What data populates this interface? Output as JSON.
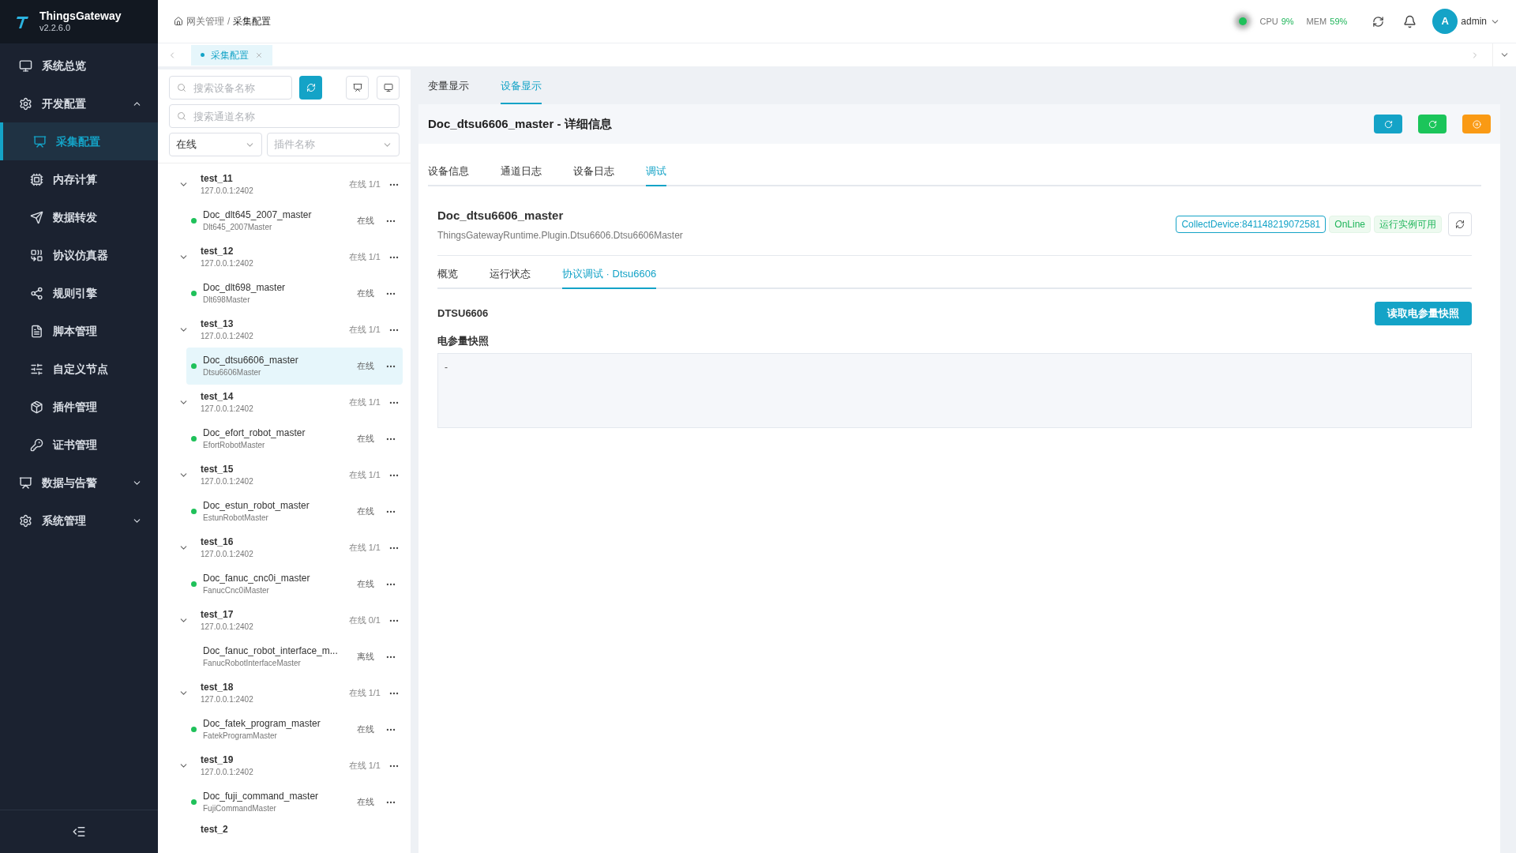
{
  "app": {
    "name": "ThingsGateway",
    "version": "v2.2.6.0"
  },
  "sidebar": {
    "items": [
      {
        "label": "系统总览",
        "selected": false
      },
      {
        "label": "开发配置",
        "expanded": true,
        "children": [
          {
            "label": "采集配置",
            "selected": true
          },
          {
            "label": "内存计算",
            "selected": false
          },
          {
            "label": "数据转发",
            "selected": false
          },
          {
            "label": "协议仿真器",
            "selected": false
          },
          {
            "label": "规则引擎",
            "selected": false
          },
          {
            "label": "脚本管理",
            "selected": false
          },
          {
            "label": "自定义节点",
            "selected": false
          },
          {
            "label": "插件管理",
            "selected": false
          },
          {
            "label": "证书管理",
            "selected": false
          }
        ]
      },
      {
        "label": "数据与告警",
        "expanded": false
      },
      {
        "label": "系统管理",
        "expanded": false
      }
    ]
  },
  "breadcrumb": [
    "网关管理",
    "采集配置"
  ],
  "breadcrumb_separator": "/",
  "status": {
    "online": true,
    "cpu_label": "CPU",
    "cpu": "9%",
    "mem_label": "MEM",
    "mem": "59%",
    "avatar": "A",
    "user": "admin"
  },
  "page_tabs": [
    {
      "label": "采集配置",
      "selected": true
    }
  ],
  "device_panel": {
    "device_search": {
      "placeholder": "搜索设备名称"
    },
    "channel_search": {
      "placeholder": "搜索通道名称"
    },
    "status_filter": {
      "value": "在线"
    },
    "plugin_filter": {
      "placeholder": "插件名称"
    },
    "groups": [
      {
        "name": "test_11",
        "address": "127.0.0.1:2402",
        "summary": "在线 1/1",
        "expanded": true,
        "children": [
          {
            "name": "Doc_dlt645_2007_master",
            "plugin": "Dlt645_2007Master",
            "status": "在线",
            "online": true,
            "selected": false
          }
        ]
      },
      {
        "name": "test_12",
        "address": "127.0.0.1:2402",
        "summary": "在线 1/1",
        "expanded": true,
        "children": [
          {
            "name": "Doc_dlt698_master",
            "plugin": "Dlt698Master",
            "status": "在线",
            "online": true,
            "selected": false
          }
        ]
      },
      {
        "name": "test_13",
        "address": "127.0.0.1:2402",
        "summary": "在线 1/1",
        "expanded": true,
        "children": [
          {
            "name": "Doc_dtsu6606_master",
            "plugin": "Dtsu6606Master",
            "status": "在线",
            "online": true,
            "selected": true
          }
        ]
      },
      {
        "name": "test_14",
        "address": "127.0.0.1:2402",
        "summary": "在线 1/1",
        "expanded": true,
        "children": [
          {
            "name": "Doc_efort_robot_master",
            "plugin": "EfortRobotMaster",
            "status": "在线",
            "online": true,
            "selected": false
          }
        ]
      },
      {
        "name": "test_15",
        "address": "127.0.0.1:2402",
        "summary": "在线 1/1",
        "expanded": true,
        "children": [
          {
            "name": "Doc_estun_robot_master",
            "plugin": "EstunRobotMaster",
            "status": "在线",
            "online": true,
            "selected": false
          }
        ]
      },
      {
        "name": "test_16",
        "address": "127.0.0.1:2402",
        "summary": "在线 1/1",
        "expanded": true,
        "children": [
          {
            "name": "Doc_fanuc_cnc0i_master",
            "plugin": "FanucCnc0iMaster",
            "status": "在线",
            "online": true,
            "selected": false
          }
        ]
      },
      {
        "name": "test_17",
        "address": "127.0.0.1:2402",
        "summary": "在线 0/1",
        "expanded": true,
        "children": [
          {
            "name": "Doc_fanuc_robot_interface_m...",
            "plugin": "FanucRobotInterfaceMaster",
            "status": "离线",
            "online": false,
            "selected": false
          }
        ]
      },
      {
        "name": "test_18",
        "address": "127.0.0.1:2402",
        "summary": "在线 1/1",
        "expanded": true,
        "children": [
          {
            "name": "Doc_fatek_program_master",
            "plugin": "FatekProgramMaster",
            "status": "在线",
            "online": true,
            "selected": false
          }
        ]
      },
      {
        "name": "test_19",
        "address": "127.0.0.1:2402",
        "summary": "在线 1/1",
        "expanded": true,
        "children": [
          {
            "name": "Doc_fuji_command_master",
            "plugin": "FujiCommandMaster",
            "status": "在线",
            "online": true,
            "selected": false
          }
        ]
      },
      {
        "name": "test_2"
      }
    ]
  },
  "detail": {
    "view_tabs": [
      {
        "label": "变量显示",
        "selected": false
      },
      {
        "label": "设备显示",
        "selected": true
      }
    ],
    "title": "Doc_dtsu6606_master - 详细信息",
    "actions": [
      {
        "color": "#14a3c7"
      },
      {
        "color": "#1bc55a"
      },
      {
        "color": "#fa9a14"
      }
    ],
    "tabs": [
      {
        "label": "设备信息",
        "selected": false
      },
      {
        "label": "通道日志",
        "selected": false
      },
      {
        "label": "设备日志",
        "selected": false
      },
      {
        "label": "调试",
        "selected": true
      }
    ],
    "device_name": "Doc_dtsu6606_master",
    "device_class": "ThingsGatewayRuntime.Plugin.Dtsu6606.Dtsu6606Master",
    "tags": [
      {
        "text": "CollectDevice:841148219072581",
        "kind": "outline"
      },
      {
        "text": "OnLine",
        "kind": "success"
      },
      {
        "text": "运行实例可用",
        "kind": "success"
      }
    ],
    "sub_tabs": [
      {
        "label": "概览",
        "selected": false
      },
      {
        "label": "运行状态",
        "selected": false
      },
      {
        "label": "协议调试 · Dtsu6606",
        "selected": true
      }
    ],
    "section_title": "DTSU6606",
    "read_button": "读取电参量快照",
    "snapshot_label": "电参量快照",
    "snapshot_value": "-"
  }
}
